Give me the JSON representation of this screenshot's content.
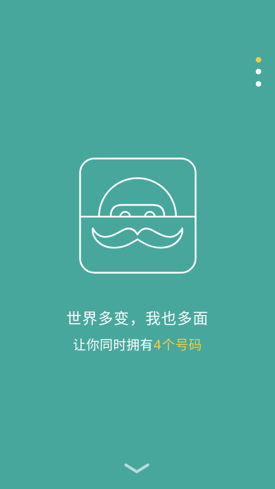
{
  "pager": {
    "total_pages": 3,
    "current_page": 1
  },
  "colors": {
    "background": "#47a79d",
    "accent": "#f2cf3d",
    "text": "#ffffff",
    "arrow": "#b8ddd8"
  },
  "logo": {
    "icon": "mustache-face-icon"
  },
  "headline": "世界多变，我也多面",
  "subline": {
    "before": "让你同时拥有",
    "highlight": "4个号码",
    "after": ""
  },
  "navigation": {
    "next_icon": "chevron-down-icon"
  }
}
